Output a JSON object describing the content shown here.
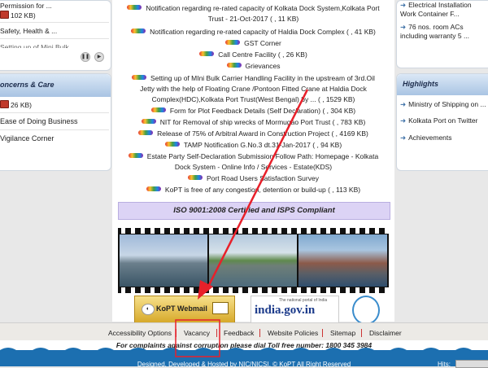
{
  "left": {
    "box1": {
      "rows": [
        "Permission for ...",
        "102 KB)",
        "Safety, Health & ...",
        "Setting up of Mini Bulk..."
      ]
    },
    "box2": {
      "title": "oncerns & Care",
      "rows": [
        "26 KB)",
        "Ease of Doing Business",
        "Vigilance Corner"
      ]
    }
  },
  "right": {
    "box1": {
      "rows": [
        "Electrical Installation Work Container F...",
        "76 nos. room ACs including warranty 5 ..."
      ]
    },
    "highlights": {
      "title": "Highlights",
      "items": [
        "Ministry of Shipping on ...",
        "Kolkata Port on Twitter",
        "Achievements"
      ]
    }
  },
  "news": [
    "Notification regarding re-rated capacity of Kolkata Dock System,Kolkata Port",
    "Trust - 21-Oct-2017 (  , 11 KB)",
    "Notification regarding re-rated capacity of Haldia Dock Complex (  , 41 KB)",
    "GST Corner",
    "Call Centre Facility (  , 26 KB)",
    "Grievances",
    "Setting up of MIni Bulk Carrier Handling Facility in the upstream of 3rd.Oil",
    "Jetty with the help of Floating Crane /Pontoon Fitted Crane at Haldia Dock",
    "Complex(HDC),Kolkata Port Trust(West Bengal) by ... (  , 1529 KB)",
    "Form for Plot Feedback Details (Self Declaration) (  , 304 KB)",
    "NIT for Removal of ship wrecks of Mormugao Port Trust (  , 783 KB)",
    "Release of 75% of Arbitral Award in Construction Project (  , 4169 KB)",
    "TAMP Notification G.No.3 dt.31-Jan-2017 (  , 94 KB)",
    "Estate Party Self-Declaration Submission Follow Path: Homepage - Kolkata",
    "Dock System - Online Info / Services - Estate(KDS)",
    "Port Road Users Satisfaction Survey",
    "KoPT is free of any congestion, detention or build-up (  , 113 KB)"
  ],
  "iso": "ISO 9001:2008 Certified and ISPS Compliant",
  "banners": {
    "webmail": "KoPT Webmail",
    "india_small": "The national portal of India",
    "india": "india.gov.in"
  },
  "footer": {
    "links": [
      "Accessibility Options",
      "Vacancy",
      "Feedback",
      "Website Policies",
      "Sitemap",
      "Disclaimer"
    ],
    "complaint": "For complaints against corruption please dial Toll free number: 1800 345 3984",
    "designed": "Designed, Developed & Hosted by NIC/NICSI, © KoPT All Right Reserved",
    "hits_label": "Hits:"
  },
  "colors": {
    "accent": "#1c6fb0",
    "arrow": "#e8202a",
    "iso_bg": "#dcd3f5"
  }
}
